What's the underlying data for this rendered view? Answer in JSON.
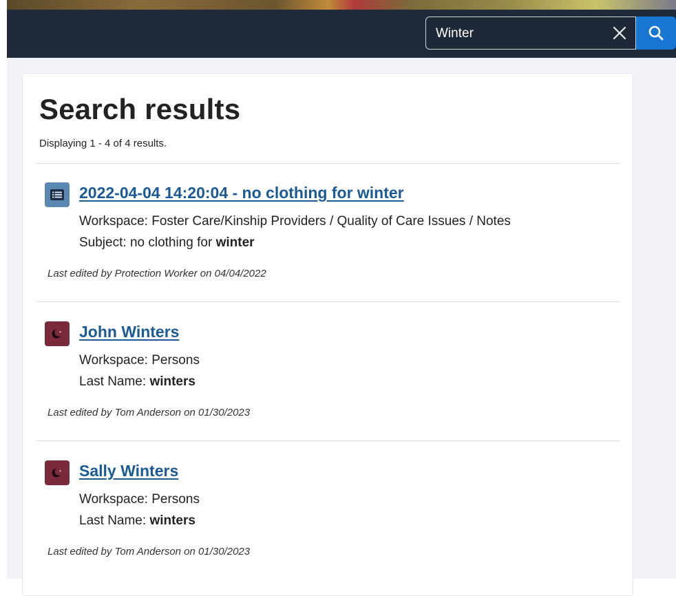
{
  "header": {
    "search": {
      "value": "Winter",
      "clear_icon": "close-icon",
      "search_icon": "search-icon"
    }
  },
  "main": {
    "title": "Search results",
    "result_count": "Displaying 1 - 4 of 4 results.",
    "results": [
      {
        "icon": "note-icon",
        "title": "2022-04-04 14:20:04 - no clothing for winter",
        "workspace": "Workspace: Foster Care/Kinship Providers / Quality of Care Issues / Notes",
        "field_label": "Subject: ",
        "field_prefix": "no clothing for ",
        "field_match": "winter",
        "last_edited": "Last edited by Protection Worker on 04/04/2022"
      },
      {
        "icon": "person-icon",
        "title": "John Winters",
        "workspace": "Workspace: Persons",
        "field_label": "Last Name: ",
        "field_prefix": "",
        "field_match": "winters",
        "last_edited": "Last edited by Tom Anderson on 01/30/2023"
      },
      {
        "icon": "person-icon",
        "title": "Sally Winters",
        "workspace": "Workspace: Persons",
        "field_label": "Last Name: ",
        "field_prefix": "",
        "field_match": "winters",
        "last_edited": "Last edited by Tom Anderson on 01/30/2023"
      }
    ]
  },
  "colors": {
    "header_bg": "#212a38",
    "accent": "#1976d2",
    "link": "#1a5a96",
    "note_icon_bg": "#5b87b3",
    "person_icon_bg": "#7a2a3a"
  }
}
